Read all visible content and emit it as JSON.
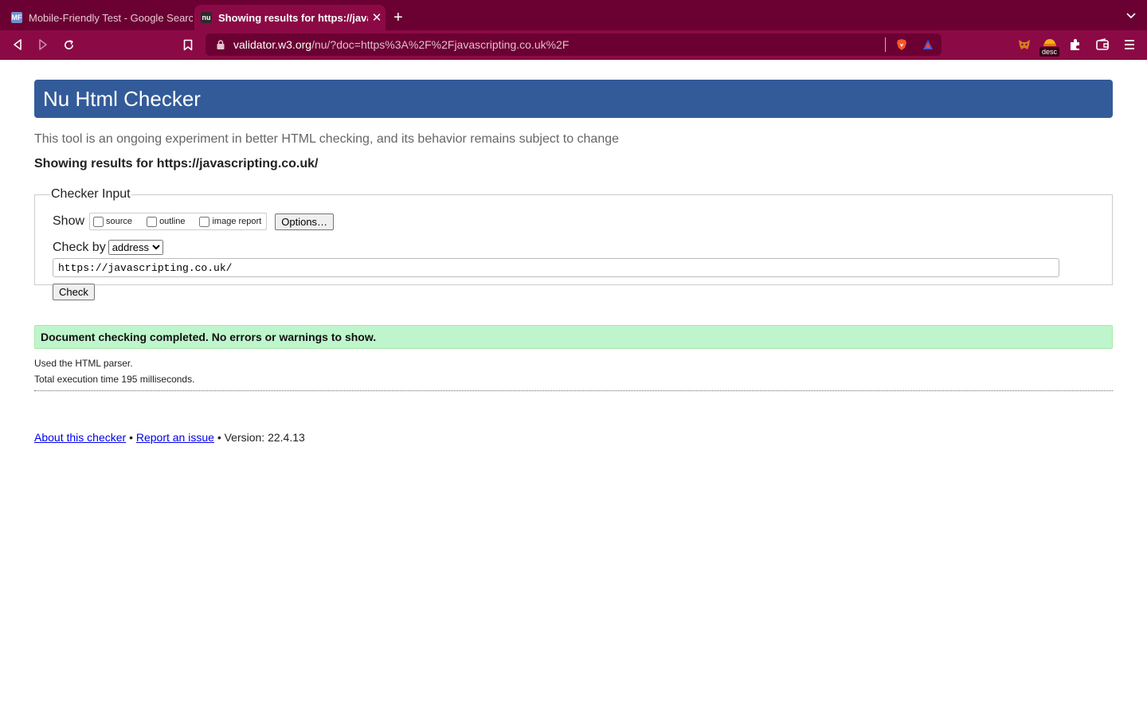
{
  "browser": {
    "tabs": [
      {
        "title": "Mobile-Friendly Test - Google Search Console",
        "favicon": "MF",
        "active": false
      },
      {
        "title": "Showing results for https://javascripting.co.uk/ - Nu Html Checker",
        "favicon": "nu",
        "active": true
      }
    ],
    "address": {
      "host": "validator.w3.org",
      "path": "/nu/?doc=https%3A%2F%2Fjavascripting.co.uk%2F"
    },
    "extension_badge": "desc",
    "colors": {
      "tabstrip": "#6b0032",
      "toolbar": "#8b0a45"
    }
  },
  "page": {
    "heading": "Nu Html Checker",
    "intro": "This tool is an ongoing experiment in better HTML checking, and its behavior remains subject to change",
    "showing_results": "Showing results for https://javascripting.co.uk/",
    "checker_input": {
      "legend": "Checker Input",
      "show_label": "Show",
      "show_options": [
        {
          "label": "source",
          "checked": false
        },
        {
          "label": "outline",
          "checked": false
        },
        {
          "label": "image report",
          "checked": false
        }
      ],
      "options_button": "Options…",
      "check_by_label": "Check by",
      "check_by_value": "address",
      "url_value": "https://javascripting.co.uk/",
      "check_button": "Check"
    },
    "result": "Document checking completed. No errors or warnings to show.",
    "details": [
      "Used the HTML parser.",
      "Total execution time 195 milliseconds."
    ],
    "footer": {
      "about_link": "About this checker",
      "separator": "•",
      "report_link": "Report an issue",
      "version": "Version: 22.4.13"
    },
    "colors": {
      "banner": "#335b99",
      "success": "#bff5cc"
    }
  }
}
